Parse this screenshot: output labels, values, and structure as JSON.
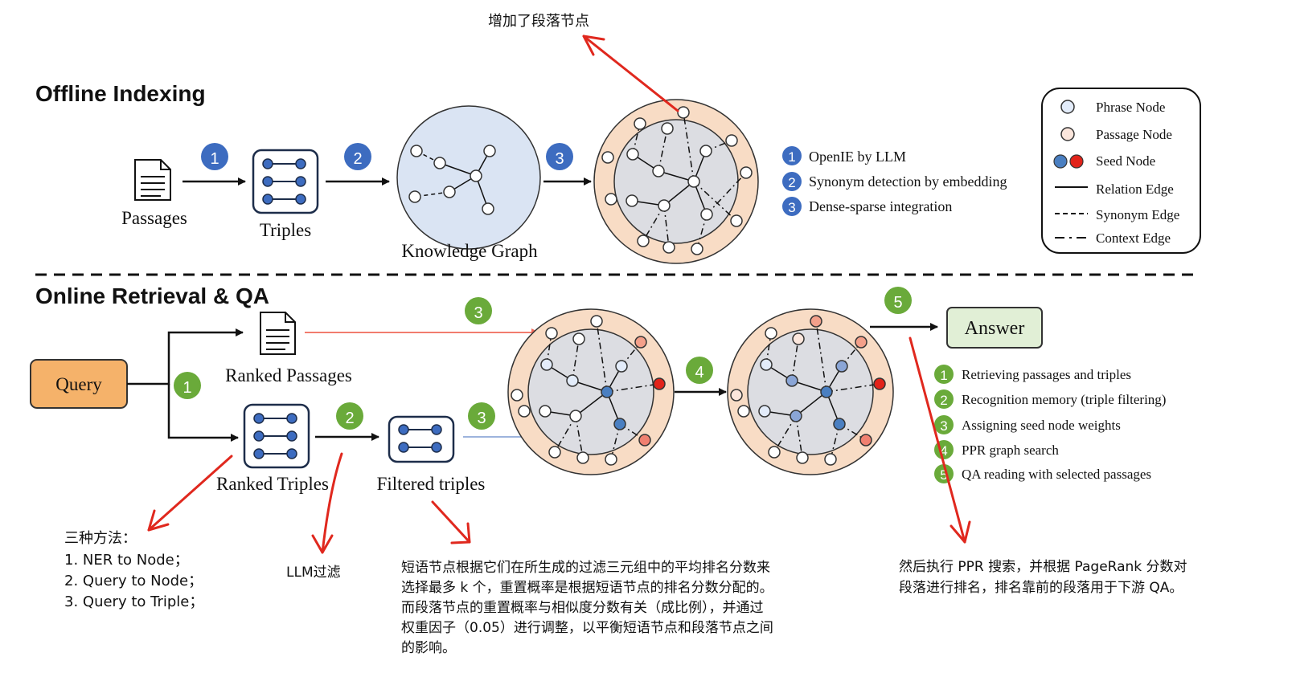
{
  "offline": {
    "title": "Offline Indexing",
    "passages_label": "Passages",
    "triples_label": "Triples",
    "kg_label": "Knowledge Graph",
    "steps": [
      "1",
      "2",
      "3"
    ],
    "legend_steps": [
      {
        "num": "1",
        "text": "OpenIE by LLM"
      },
      {
        "num": "2",
        "text": "Synonym detection by embedding"
      },
      {
        "num": "3",
        "text": "Dense-sparse integration"
      }
    ]
  },
  "legend": {
    "items": [
      {
        "icon": "phrase-node-icon",
        "text": "Phrase Node"
      },
      {
        "icon": "passage-node-icon",
        "text": "Passage Node"
      },
      {
        "icon": "seed-node-icon",
        "text": "Seed Node"
      },
      {
        "icon": "relation-edge-icon",
        "text": "Relation Edge"
      },
      {
        "icon": "synonym-edge-icon",
        "text": "Synonym Edge"
      },
      {
        "icon": "context-edge-icon",
        "text": "Context Edge"
      }
    ]
  },
  "online": {
    "title": "Online Retrieval & QA",
    "query_label": "Query",
    "ranked_passages_label": "Ranked Passages",
    "ranked_triples_label": "Ranked Triples",
    "filtered_triples_label": "Filtered triples",
    "answer_label": "Answer",
    "steps": [
      "1",
      "2",
      "3",
      "3",
      "4",
      "5"
    ],
    "legend_steps": [
      {
        "num": "1",
        "text": "Retrieving passages and triples"
      },
      {
        "num": "2",
        "text": "Recognition memory (triple filtering)"
      },
      {
        "num": "3",
        "text": "Assigning seed node weights"
      },
      {
        "num": "4",
        "text": "PPR graph search"
      },
      {
        "num": "5",
        "text": "QA reading with selected passages"
      }
    ]
  },
  "annotations": {
    "added_nodes": "增加了段落节点",
    "three_methods": [
      "三种方法：",
      "1. NER to Node；",
      "2. Query to Node；",
      "3. Query to Triple；"
    ],
    "llm_filter": "LLM过滤",
    "phrase_weights": [
      "短语节点根据它们在所生成的过滤三元组中的平均排名分数来",
      "选择最多 k 个，重置概率是根据短语节点的排名分数分配的。",
      "而段落节点的重置概率与相似度分数有关（成比例），并通过",
      "权重因子（0.05）进行调整，以平衡短语节点和段落节点之间",
      "的影响。"
    ],
    "ppr_note": [
      "然后执行 PPR 搜索，并根据 PageRank 分数对",
      "段落进行排名，排名靠前的段落用于下游 QA。"
    ]
  },
  "colors": {
    "step_blue": "#3d6cc0",
    "step_green": "#6aaa3a",
    "kg_fill": "#dae4f3",
    "ring_fill": "#f8dcc5",
    "query_fill": "#f5b26a",
    "answer_fill": "#e1efd6",
    "seed_blue": "#4a7fc1",
    "seed_red": "#e2231a",
    "annot_red": "#e0281e"
  }
}
